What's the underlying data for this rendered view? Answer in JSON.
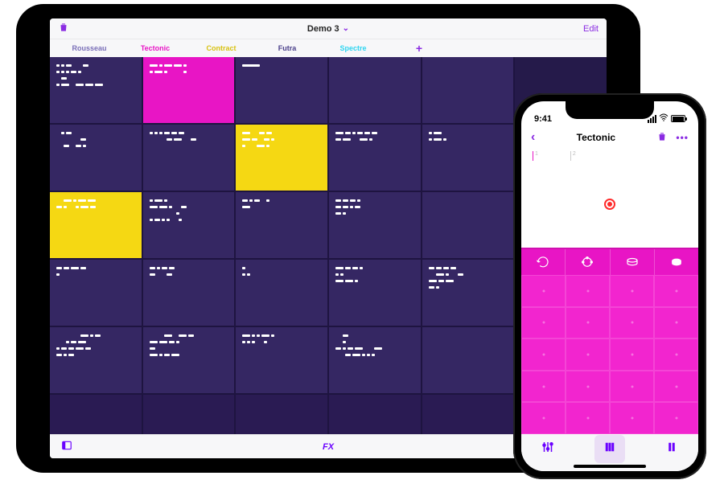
{
  "ipad": {
    "project_title": "Demo 3",
    "edit_label": "Edit",
    "fx_label": "FX",
    "instruments": [
      {
        "label": "Rousseau",
        "color": "#3a2f7a"
      },
      {
        "label": "Tectonic",
        "color": "#e815c5"
      },
      {
        "label": "Contract",
        "color": "#f5d813"
      },
      {
        "label": "Futra",
        "color": "#3a2f7a"
      },
      {
        "label": "Spectre",
        "color": "#2fd5f0"
      }
    ],
    "add_label": "+",
    "grid_rows": 6,
    "grid_cols": 6,
    "active_cells": [
      {
        "row": 0,
        "col": 1,
        "variant": "magenta"
      },
      {
        "row": 1,
        "col": 2,
        "variant": "yellow"
      },
      {
        "row": 2,
        "col": 0,
        "variant": "yellow"
      },
      {
        "row": 2,
        "col": 5,
        "variant": "cyan"
      }
    ]
  },
  "iphone": {
    "time": "9:41",
    "title": "Tectonic",
    "timeline_ticks": [
      "1",
      "2"
    ],
    "drum_columns": 4,
    "drum_rows": 5,
    "drum_icons": [
      "loop-icon",
      "tambourine-icon",
      "snare-icon",
      "tom-icon"
    ]
  },
  "colors": {
    "purple": "#6a00ff",
    "magenta": "#e815c5",
    "yellow": "#f5d813",
    "cyan": "#2fd5f0",
    "grid_bg": "#2a1b53",
    "cell_bg": "#352763"
  }
}
